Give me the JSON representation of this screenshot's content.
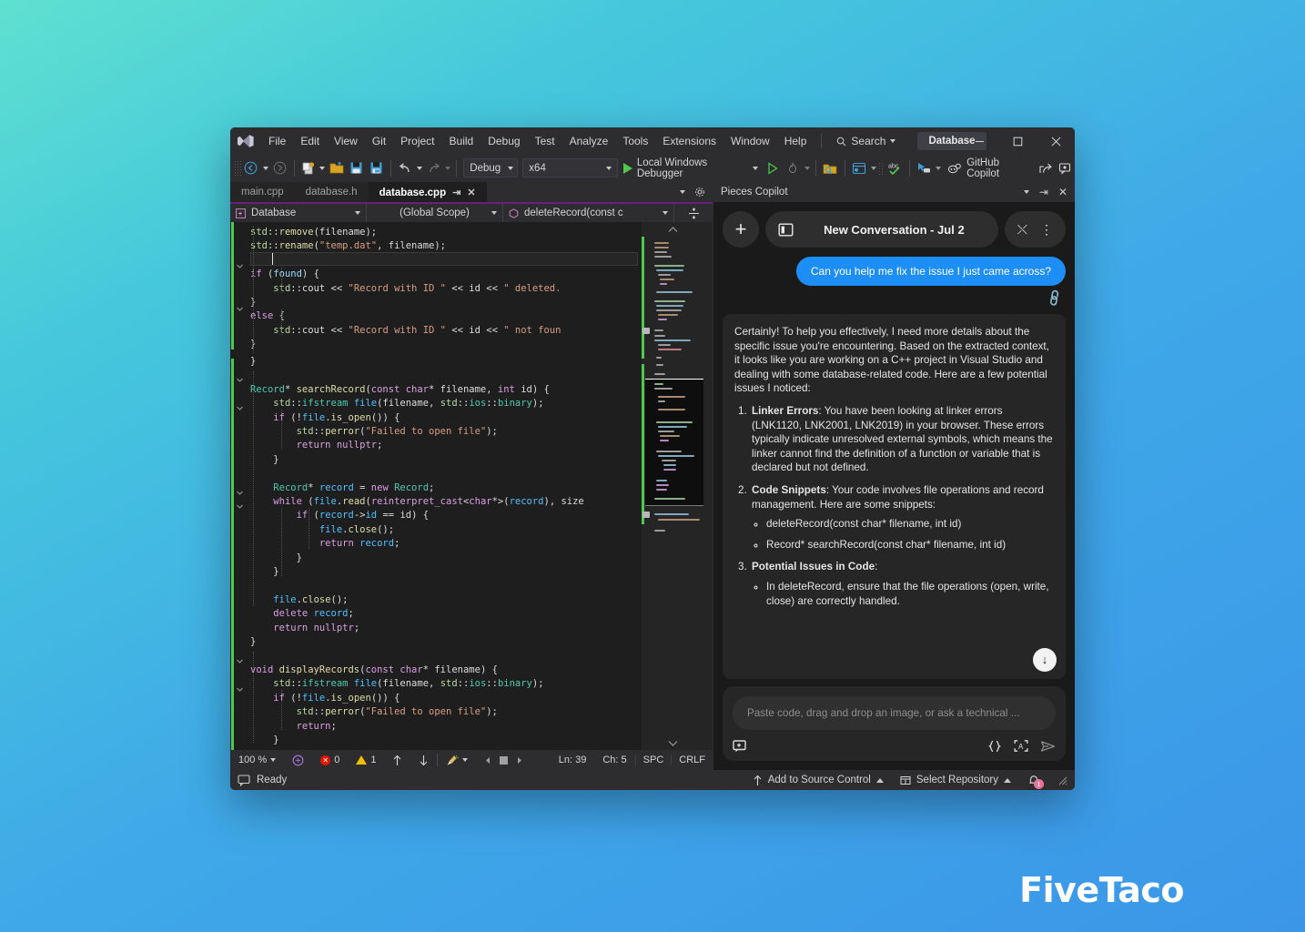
{
  "app": {
    "logo_icon": "visual-studio-logo-icon",
    "solution_chip": "Database",
    "brand_watermark": "FiveTaco"
  },
  "menu": {
    "items": [
      "File",
      "Edit",
      "View",
      "Git",
      "Project",
      "Build",
      "Debug",
      "Test",
      "Analyze",
      "Tools",
      "Extensions",
      "Window",
      "Help"
    ],
    "search_label": "Search",
    "search_icon": "magnifier-icon"
  },
  "window_controls": {
    "minimize_icon": "minimize-icon",
    "maximize_icon": "maximize-icon",
    "close_icon": "close-icon"
  },
  "toolbar": {
    "nav_back_icon": "navigate-back-icon",
    "nav_forward_icon": "navigate-forward-icon",
    "new_item_icon": "new-item-icon",
    "open_file_icon": "open-file-icon",
    "save_icon": "save-icon",
    "save_all_icon": "save-all-icon",
    "undo_icon": "undo-icon",
    "redo_icon": "redo-icon",
    "config_value": "Debug",
    "platform_value": "x64",
    "run_label": "Local Windows Debugger",
    "run_icon": "play-icon",
    "hot_reload_icon": "hot-reload-icon",
    "search_folder_icon": "search-folder-icon",
    "window_layout_icon": "window-layout-icon",
    "spell_check_icon": "spell-check-abc-icon",
    "pointer_icon": "live-visual-tree-icon",
    "copilot_label": "GitHub Copilot",
    "copilot_icon": "github-copilot-icon",
    "share_icon": "share-icon",
    "feedback_icon": "feedback-icon"
  },
  "editor": {
    "tabs": [
      {
        "label": "main.cpp",
        "active": false
      },
      {
        "label": "database.h",
        "active": false
      },
      {
        "label": "database.cpp",
        "active": true
      }
    ],
    "tab_pin_icon": "pin-icon",
    "tab_close_icon": "close-icon",
    "tab_dropdown_icon": "chevron-down-icon",
    "tab_settings_icon": "gear-icon",
    "breadcrumb": {
      "project": "Database",
      "project_icon": "cpp-project-icon",
      "scope": "(Global Scope)",
      "member": "deleteRecord(const c",
      "member_icon": "method-cube-icon",
      "split_icon": "split-editor-icon"
    },
    "code_lines": [
      "        std::remove(filename);",
      "        std::rename(\"temp.dat\", filename);",
      "",
      "        if (found) {",
      "            std::cout << \"Record with ID \" << id << \" deleted.",
      "        }",
      "        else {",
      "            std::cout << \"Record with ID \" << id << \" not foun",
      "        }",
      "    }",
      "",
      "    Record* searchRecord(const char* filename, int id) {",
      "        std::ifstream file(filename, std::ios::binary);",
      "        if (!file.is_open()) {",
      "            std::perror(\"Failed to open file\");",
      "            return nullptr;",
      "        }",
      "",
      "        Record* record = new Record;",
      "        while (file.read(reinterpret_cast<char*>(record), size",
      "            if (record->id == id) {",
      "                file.close();",
      "                return record;",
      "            }",
      "        }",
      "",
      "        file.close();",
      "        delete record;",
      "        return nullptr;",
      "    }",
      "",
      "    void displayRecords(const char* filename) {",
      "        std::ifstream file(filename, std::ios::binary);",
      "        if (!file.is_open()) {",
      "            std::perror(\"Failed to open file\");",
      "            return;",
      "        }"
    ],
    "status": {
      "zoom": "100 %",
      "zoom_dropdown_icon": "chevron-down-icon",
      "intellisense_icon": "intellisense-icon",
      "error_count": "0",
      "error_icon": "error-icon",
      "warning_count": "1",
      "warning_icon": "warning-icon",
      "prev_issue_icon": "arrow-up-icon",
      "next_issue_icon": "arrow-down-icon",
      "cleanup_icon": "code-cleanup-broom-icon",
      "nav_prev_icon": "arrow-left-icon",
      "nav_stop_icon": "stop-square-icon",
      "nav_next_icon": "arrow-right-icon",
      "line": "Ln: 39",
      "column": "Ch: 5",
      "indent": "SPC",
      "line_ending": "CRLF"
    }
  },
  "copilot": {
    "panel_title": "Pieces Copilot",
    "panel_dropdown_icon": "chevron-down-icon",
    "panel_pin_icon": "pin-icon",
    "panel_close_icon": "close-icon",
    "new_chat_icon": "plus-icon",
    "sidebar_toggle_icon": "panel-layout-icon",
    "conversation_title": "New Conversation - Jul 2",
    "collapse_icon": "collapse-icon",
    "more_icon": "kebab-menu-icon",
    "user_message": "Can you help me fix the issue I just came across?",
    "attachment_icon": "paperclip-icon",
    "reply": {
      "intro": "Certainly! To help you effectively, I need more details about the specific issue you're encountering. Based on the extracted context, it looks like you are working on a C++ project in Visual Studio and dealing with some database-related code. Here are a few potential issues I noticed:",
      "items": [
        {
          "title": "Linker Errors",
          "text": ": You have been looking at linker errors (LNK1120, LNK2001, LNK2019) in your browser. These errors typically indicate unresolved external symbols, which means the linker cannot find the definition of a function or variable that is declared but not defined.",
          "sub": []
        },
        {
          "title": "Code Snippets",
          "text": ": Your code involves file operations and record management. Here are some snippets:",
          "sub": [
            "deleteRecord(const char* filename, int id)",
            "Record* searchRecord(const char* filename, int id)"
          ]
        },
        {
          "title": "Potential Issues in Code",
          "text": ":",
          "sub": [
            "In deleteRecord, ensure that the file operations (open, write, close) are correctly handled."
          ]
        }
      ]
    },
    "scroll_down_icon": "scroll-to-bottom-icon",
    "input_placeholder": "Paste code, drag and drop an image, or ask a technical ...",
    "input_value": "",
    "add_context_icon": "add-context-icon",
    "code_icon": "curly-braces-icon",
    "ocr_icon": "scan-text-icon",
    "send_icon": "send-icon"
  },
  "status_bar": {
    "ready_icon": "callout-icon",
    "ready_label": "Ready",
    "add_to_source_control": "Add to Source Control",
    "add_to_source_control_icon": "arrow-up-icon",
    "select_repository": "Select Repository",
    "select_repository_icon": "repository-icon",
    "notification_icon": "bell-icon",
    "notification_count": "1",
    "resize_icon": "resize-grip-icon"
  },
  "colors": {
    "accent_blue": "#1d8ef5",
    "tab_accent": "#68217a",
    "run_green": "#4ec94e",
    "error_red": "#e51400",
    "warning_yellow": "#f0c000"
  }
}
